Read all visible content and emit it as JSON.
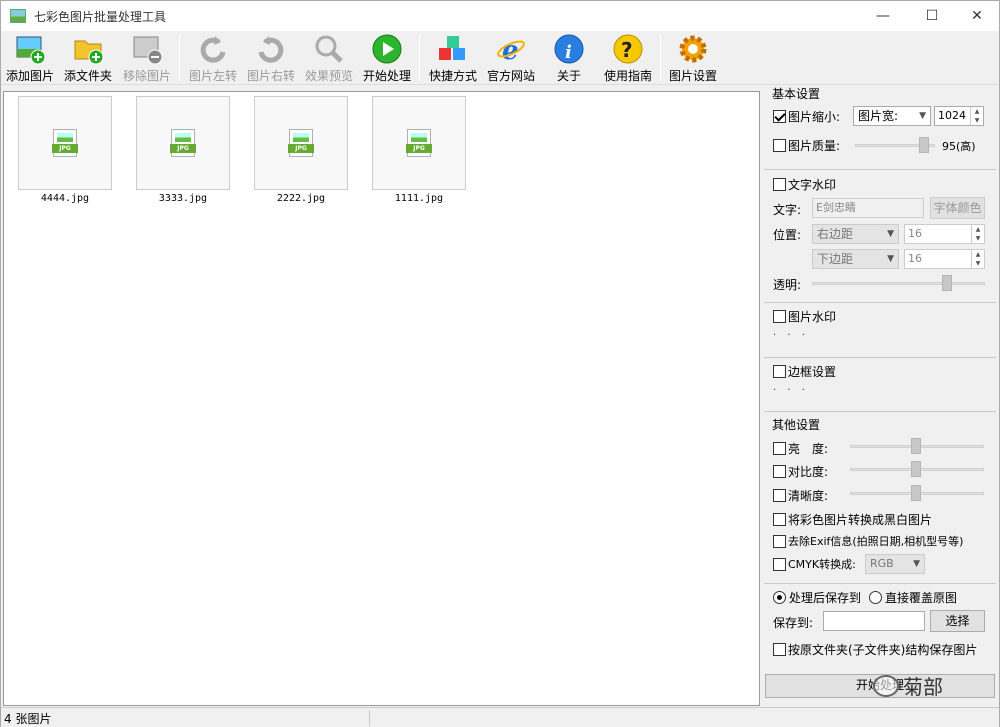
{
  "window": {
    "title": "七彩色图片批量处理工具"
  },
  "toolbar": {
    "add_image": "添加图片",
    "add_folder": "添文件夹",
    "remove_image": "移除图片",
    "rotate_left": "图片左转",
    "rotate_right": "图片右转",
    "preview": "效果预览",
    "start": "开始处理",
    "shortcut": "快捷方式",
    "website": "官方网站",
    "about": "关于",
    "guide": "使用指南",
    "settings": "图片设置"
  },
  "files": [
    {
      "name": "4444.jpg"
    },
    {
      "name": "3333.jpg"
    },
    {
      "name": "2222.jpg"
    },
    {
      "name": "1111.jpg"
    }
  ],
  "thumb_badge": "JPG",
  "basic": {
    "title": "基本设置",
    "resize_label": "图片缩小:",
    "resize_checked": true,
    "resize_mode": "图片宽:",
    "resize_value": "1024",
    "quality_label": "图片质量:",
    "quality_checked": false,
    "quality_value": "95(高)",
    "quality_level": 95
  },
  "text_watermark": {
    "title": "文字水印",
    "checked": false,
    "text_label": "文字:",
    "text_value": "E剑忠睛",
    "font_color_btn": "字体颜色",
    "position_label": "位置:",
    "h_pos": "右边距",
    "h_value": "16",
    "v_pos": "下边距",
    "v_value": "16",
    "opacity_label": "透明:",
    "opacity_level": 0.9
  },
  "image_watermark": {
    "title": "图片水印",
    "checked": false,
    "more": "· · ·"
  },
  "border": {
    "title": "边框设置",
    "checked": false,
    "more": "· · ·"
  },
  "other": {
    "title": "其他设置",
    "brightness": "亮　度:",
    "contrast": "对比度:",
    "sharpness": "清晰度:",
    "grayscale": "将彩色图片转换成黑白图片",
    "remove_exif": "去除Exif信息(拍照日期,相机型号等)",
    "cmyk": "CMYK转换成:",
    "cmyk_value": "RGB"
  },
  "save": {
    "save_to_option": "处理后保存到",
    "overwrite_option": "直接覆盖原图",
    "save_to_label": "保存到:",
    "save_path": "",
    "choose_btn": "选择",
    "keep_structure": "按原文件夹(子文件夹)结构保存图片",
    "start_btn": "开始处理"
  },
  "status": {
    "count": "4 张图片"
  },
  "watermark_text": "菊部"
}
